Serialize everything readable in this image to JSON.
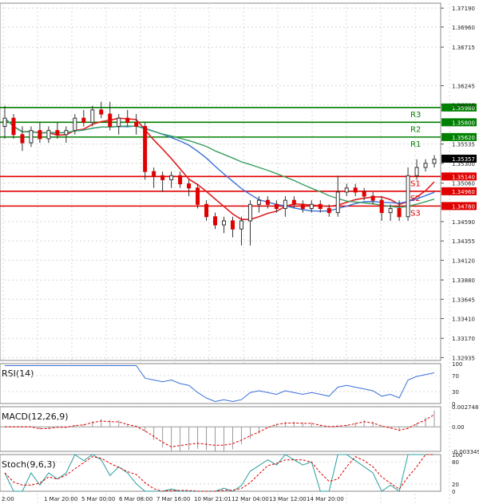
{
  "chart_data": [
    {
      "type": "candlestick",
      "panel": "price",
      "ylim": [
        1.329,
        1.3725
      ],
      "y_ticks": [
        "1.37190",
        "1.36960",
        "1.36715",
        "1.36245",
        "1.36010",
        "1.35535",
        "1.35300",
        "1.35060",
        "1.34590",
        "1.34355",
        "1.34120",
        "1.33880",
        "1.33645",
        "1.33410",
        "1.33170",
        "1.32935"
      ],
      "x_ticks": [
        "2:00",
        "1 Mar 20:00",
        "5 Mar 00:00",
        "6 Mar 08:00",
        "7 Mar 16:00",
        "10 Mar 21:01",
        "12 Mar 04:00",
        "13 Mar 12:00",
        "14 Mar 20:00"
      ],
      "last_price": "1.35357",
      "levels": [
        {
          "name": "R3",
          "value": 1.3598,
          "label": "1.35980",
          "color": "#008000"
        },
        {
          "name": "R2",
          "value": 1.358,
          "label": "1.35800",
          "color": "#008000"
        },
        {
          "name": "R1",
          "value": 1.3562,
          "label": "1.35620",
          "color": "#008000"
        },
        {
          "name": "S1",
          "value": 1.3514,
          "label": "1.35140",
          "color": "#e00000"
        },
        {
          "name": "S2",
          "value": 1.3496,
          "label": "1.34960",
          "color": "#e00000"
        },
        {
          "name": "S3",
          "value": 1.3478,
          "label": "1.34780",
          "color": "#e00000"
        }
      ],
      "candles": [
        [
          1.3575,
          1.36,
          1.356,
          1.3585
        ],
        [
          1.3585,
          1.359,
          1.356,
          1.3565
        ],
        [
          1.3565,
          1.3575,
          1.3545,
          1.3555
        ],
        [
          1.3555,
          1.3575,
          1.355,
          1.357
        ],
        [
          1.357,
          1.358,
          1.3555,
          1.356
        ],
        [
          1.356,
          1.3575,
          1.3555,
          1.357
        ],
        [
          1.357,
          1.358,
          1.356,
          1.3565
        ],
        [
          1.3565,
          1.3575,
          1.3555,
          1.357
        ],
        [
          1.357,
          1.359,
          1.3565,
          1.3585
        ],
        [
          1.3585,
          1.3595,
          1.3575,
          1.358
        ],
        [
          1.358,
          1.36,
          1.3575,
          1.3595
        ],
        [
          1.3595,
          1.3605,
          1.3585,
          1.359
        ],
        [
          1.359,
          1.3605,
          1.357,
          1.3575
        ],
        [
          1.3575,
          1.359,
          1.3565,
          1.3585
        ],
        [
          1.3585,
          1.3595,
          1.3575,
          1.358
        ],
        [
          1.358,
          1.359,
          1.3565,
          1.3575
        ],
        [
          1.3575,
          1.358,
          1.351,
          1.352
        ],
        [
          1.352,
          1.3525,
          1.35,
          1.3515
        ],
        [
          1.3515,
          1.352,
          1.3495,
          1.351
        ],
        [
          1.351,
          1.352,
          1.35,
          1.3515
        ],
        [
          1.3515,
          1.352,
          1.35,
          1.3505
        ],
        [
          1.3505,
          1.351,
          1.349,
          1.35
        ],
        [
          1.35,
          1.3505,
          1.3475,
          1.348
        ],
        [
          1.348,
          1.3485,
          1.346,
          1.3465
        ],
        [
          1.3465,
          1.347,
          1.345,
          1.3455
        ],
        [
          1.3455,
          1.3465,
          1.3445,
          1.346
        ],
        [
          1.346,
          1.3465,
          1.344,
          1.345
        ],
        [
          1.345,
          1.3465,
          1.343,
          1.346
        ],
        [
          1.346,
          1.3485,
          1.343,
          1.348
        ],
        [
          1.348,
          1.349,
          1.347,
          1.3485
        ],
        [
          1.3485,
          1.349,
          1.3475,
          1.348
        ],
        [
          1.348,
          1.3485,
          1.347,
          1.3475
        ],
        [
          1.3475,
          1.349,
          1.3465,
          1.3485
        ],
        [
          1.3485,
          1.349,
          1.3475,
          1.348
        ],
        [
          1.348,
          1.3485,
          1.347,
          1.3475
        ],
        [
          1.3475,
          1.3485,
          1.347,
          1.348
        ],
        [
          1.348,
          1.3485,
          1.347,
          1.3475
        ],
        [
          1.3475,
          1.348,
          1.3465,
          1.347
        ],
        [
          1.347,
          1.3515,
          1.3465,
          1.3495
        ],
        [
          1.3495,
          1.3505,
          1.349,
          1.35
        ],
        [
          1.35,
          1.3505,
          1.349,
          1.3495
        ],
        [
          1.3495,
          1.35,
          1.3485,
          1.349
        ],
        [
          1.349,
          1.3495,
          1.348,
          1.3485
        ],
        [
          1.3485,
          1.349,
          1.346,
          1.347
        ],
        [
          1.347,
          1.348,
          1.346,
          1.3475
        ],
        [
          1.3475,
          1.3485,
          1.346,
          1.3465
        ],
        [
          1.3465,
          1.3525,
          1.346,
          1.3515
        ],
        [
          1.3515,
          1.3535,
          1.351,
          1.3525
        ],
        [
          1.3525,
          1.3535,
          1.352,
          1.353
        ],
        [
          1.353,
          1.354,
          1.3525,
          1.3535
        ]
      ]
    },
    {
      "type": "line",
      "panel": "indicator",
      "title": "RSI(14)",
      "ylim": [
        0,
        100
      ],
      "y_ticks": [
        "100",
        "70",
        "30",
        "0"
      ]
    },
    {
      "type": "histogram",
      "panel": "indicator",
      "title": "MACD(12,26,9)",
      "ylim": [
        -0.003349,
        0.002748
      ],
      "y_ticks": [
        "0.002748",
        "0.00",
        "-0.003349"
      ]
    },
    {
      "type": "line",
      "panel": "indicator",
      "title": "Stoch(9,6,3)",
      "ylim": [
        0,
        100
      ],
      "y_ticks": [
        "100",
        "80",
        "20",
        "0"
      ]
    }
  ],
  "colors": {
    "bull": "#008000",
    "bear": "#e00000",
    "ma_slow": "#3a6fd8",
    "ma_mid": "#3aa060",
    "ma_fast": "#e02020",
    "grid": "#d8d8d8"
  }
}
